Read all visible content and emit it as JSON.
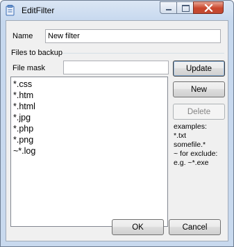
{
  "window": {
    "title": "EditFilter"
  },
  "form": {
    "name_label": "Name",
    "name_value": "New filter",
    "group_label": "Files to backup",
    "mask_label": "File mask",
    "mask_value": ""
  },
  "list": {
    "items": [
      "*.css",
      "*.htm",
      "*.html",
      "*.jpg",
      "*.php",
      "*.png",
      "~*.log"
    ]
  },
  "buttons": {
    "update": "Update",
    "new": "New",
    "delete": "Delete",
    "ok": "OK",
    "cancel": "Cancel"
  },
  "hint": {
    "lines": [
      "examples:",
      "*.txt",
      "somefile.*",
      "~ for exclude:",
      "e.g. ~*.exe"
    ]
  }
}
